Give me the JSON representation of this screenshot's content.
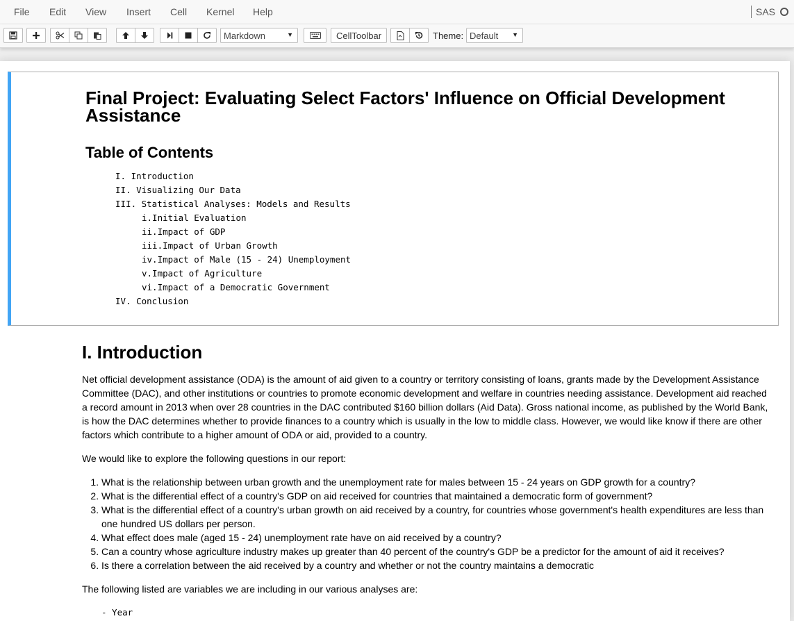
{
  "menubar": {
    "items": [
      "File",
      "Edit",
      "View",
      "Insert",
      "Cell",
      "Kernel",
      "Help"
    ],
    "kernel_name": "SAS"
  },
  "toolbar": {
    "buttons": [
      {
        "name": "save",
        "icon": "floppy-disk-icon"
      },
      {
        "name": "insert-cell",
        "icon": "plus-icon"
      },
      {
        "name": "cut",
        "icon": "scissors-icon"
      },
      {
        "name": "copy",
        "icon": "copy-icon"
      },
      {
        "name": "paste",
        "icon": "paste-icon"
      },
      {
        "name": "move-up",
        "icon": "arrow-up-icon"
      },
      {
        "name": "move-down",
        "icon": "arrow-down-icon"
      },
      {
        "name": "run",
        "icon": "step-forward-icon"
      },
      {
        "name": "interrupt",
        "icon": "stop-icon"
      },
      {
        "name": "restart",
        "icon": "refresh-icon"
      },
      {
        "name": "command-palette",
        "icon": "keyboard-icon"
      },
      {
        "name": "nbconvert",
        "icon": "export-file-icon"
      },
      {
        "name": "revert",
        "icon": "history-icon"
      }
    ],
    "cell_type": "Markdown",
    "celltoolbar_label": "CellToolbar",
    "theme_label": "Theme:",
    "theme_value": "Default"
  },
  "notebook": {
    "title": "Final Project: Evaluating Select Factors' Influence on Official Development Assistance",
    "toc_heading": "Table of Contents",
    "toc": [
      {
        "text": "I. Introduction",
        "level": 1
      },
      {
        "text": "II. Visualizing Our Data",
        "level": 1
      },
      {
        "text": "III. Statistical Analyses: Models and Results",
        "level": 1
      },
      {
        "text": "i.Initial Evaluation",
        "level": 2
      },
      {
        "text": "ii.Impact of GDP",
        "level": 2
      },
      {
        "text": "iii.Impact of Urban Growth",
        "level": 2
      },
      {
        "text": "iv.Impact of Male (15 - 24) Unemployment",
        "level": 2
      },
      {
        "text": "v.Impact of Agriculture",
        "level": 2
      },
      {
        "text": "vi.Impact of a Democratic Government",
        "level": 2
      },
      {
        "text": "IV. Conclusion",
        "level": 1
      }
    ],
    "intro_heading": "I. Introduction",
    "intro_paragraph": "Net official development assistance (ODA) is the amount of aid given to a country or territory consisting of loans, grants made by the Development Assistance Committee (DAC), and other institutions or countries to promote economic development and welfare in countries needing assistance. Development aid reached a record amount in 2013 when over 28 countries in the DAC contributed $160 billion dollars (Aid Data). Gross national income, as published by the World Bank, is how the DAC determines whether to provide finances to a country which is usually in the low to middle class. However, we would like know if there are other factors which contribute to a higher amount of ODA or aid, provided to a country.",
    "questions_intro": "We would like to explore the following questions in our report:",
    "questions": [
      "What is the relationship between urban growth and the unemployment rate for males between 15 - 24 years on GDP growth for a country?",
      "What is the differential effect of a country's GDP on aid received for countries that maintained a democratic form of government?",
      "What is the differential effect of a country's urban growth on aid received by a country, for countries whose government's health expenditures are less than one hundred US dollars per person.",
      "What effect does male (aged 15 - 24) unemployment rate have on aid received by a country?",
      "Can a country whose agriculture industry makes up greater than 40 percent of the country's GDP be a predictor for the amount of aid it receives?",
      "Is there a correlation between the aid received by a country and whether or not the country maintains a democratic"
    ],
    "variables_intro": "The following listed are variables we are including in our various analyses are:",
    "variables": [
      "- Year"
    ]
  },
  "colors": {
    "selected_cell_border": "#42a5f5",
    "menubar_bg": "#f8f8f8",
    "page_bg": "#eeeeee"
  }
}
